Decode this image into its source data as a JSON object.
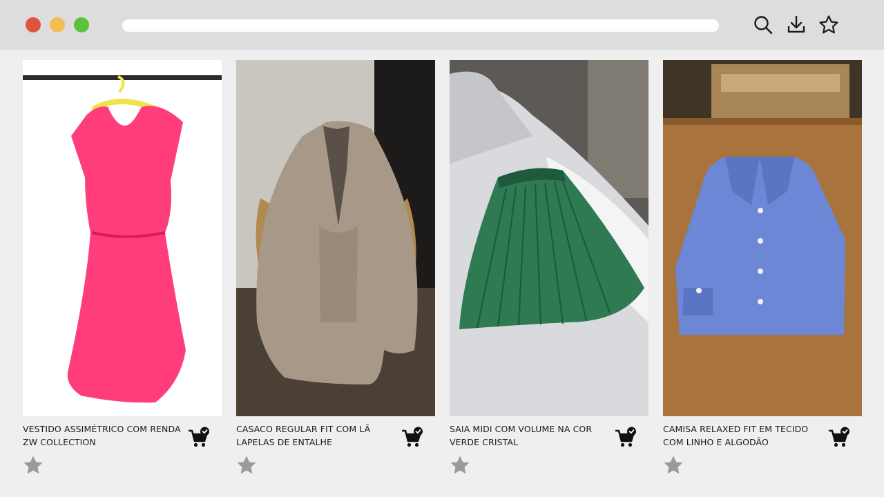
{
  "browser": {
    "window_controls": [
      "close",
      "minimize",
      "maximize"
    ],
    "colors": {
      "close": "#e0533f",
      "minimize": "#f4bd51",
      "maximize": "#5bc23a",
      "topbar": "#dddddd"
    },
    "toolbar_icons": [
      "search-icon",
      "download-icon",
      "star-icon"
    ]
  },
  "products": [
    {
      "title_line1": "VESTIDO ASSIMÉTRICO COM RENDA",
      "title_line2": "ZW COLLECTION",
      "image": "pink lace dress on hanger",
      "color": "#ff3d7a"
    },
    {
      "title_line1": "CASACO REGULAR FIT COM LÃ",
      "title_line2": "LAPELAS DE ENTALHE",
      "image": "beige coat draped on chair",
      "color": "#a89888"
    },
    {
      "title_line1": "SAIA MIDI COM VOLUME NA COR",
      "title_line2": "VERDE CRISTAL",
      "image": "green pleated skirt on bed",
      "color": "#2f7a52"
    },
    {
      "title_line1": "CAMISA RELAXED FIT EM TECIDO",
      "title_line2": "COM LINHO E ALGODÃO",
      "image": "folded blue shirt on wooden table",
      "color": "#6b87d6"
    }
  ],
  "icons": {
    "cart": "cart-check-icon",
    "favorite": "star-icon",
    "favorite_color": "#9a9a9a"
  }
}
